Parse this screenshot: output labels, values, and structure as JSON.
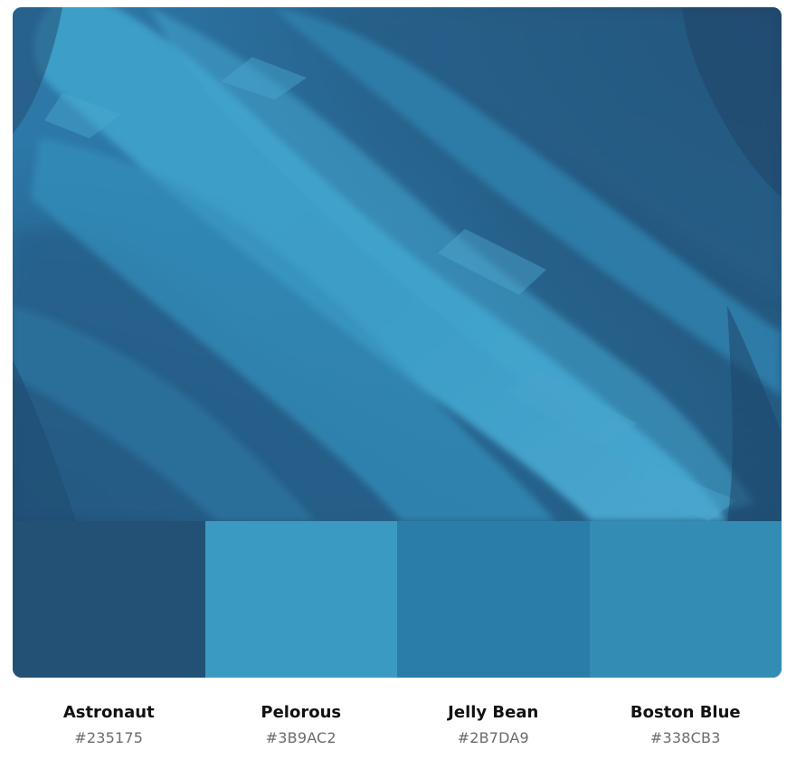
{
  "palette": {
    "hero_image_icon": "abstract-blue-brushstrokes-image",
    "colors": [
      {
        "name": "Astronaut",
        "hex": "#235175"
      },
      {
        "name": "Pelorous",
        "hex": "#3B9AC2"
      },
      {
        "name": "Jelly Bean",
        "hex": "#2B7DA9"
      },
      {
        "name": "Boston Blue",
        "hex": "#338CB3"
      }
    ]
  }
}
